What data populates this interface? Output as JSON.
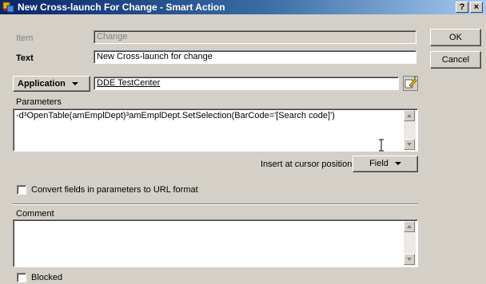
{
  "window": {
    "title": "New Cross-launch For Change - Smart Action",
    "help_btn": "?",
    "close_btn": "×"
  },
  "form": {
    "item_label": "Item",
    "item_value": "Change",
    "text_label": "Text",
    "text_value": "New Cross-launch for change",
    "application_btn": "Application",
    "application_value": "DDE TestCenter",
    "parameters_label": "Parameters",
    "parameters_value": "-d³OpenTable(amEmplDept)³amEmplDept.SetSelection(BarCode='[Search code]')",
    "insert_label": "Insert at cursor position:",
    "field_btn": "Field",
    "convert_label": "Convert fields in parameters to URL format",
    "comment_label": "Comment",
    "comment_value": "",
    "blocked_label": "Blocked"
  },
  "buttons": {
    "ok": "OK",
    "cancel": "Cancel"
  },
  "icons": {
    "app_icon": "smart-action-icon",
    "edit_icon": "edit-pencil-icon"
  }
}
